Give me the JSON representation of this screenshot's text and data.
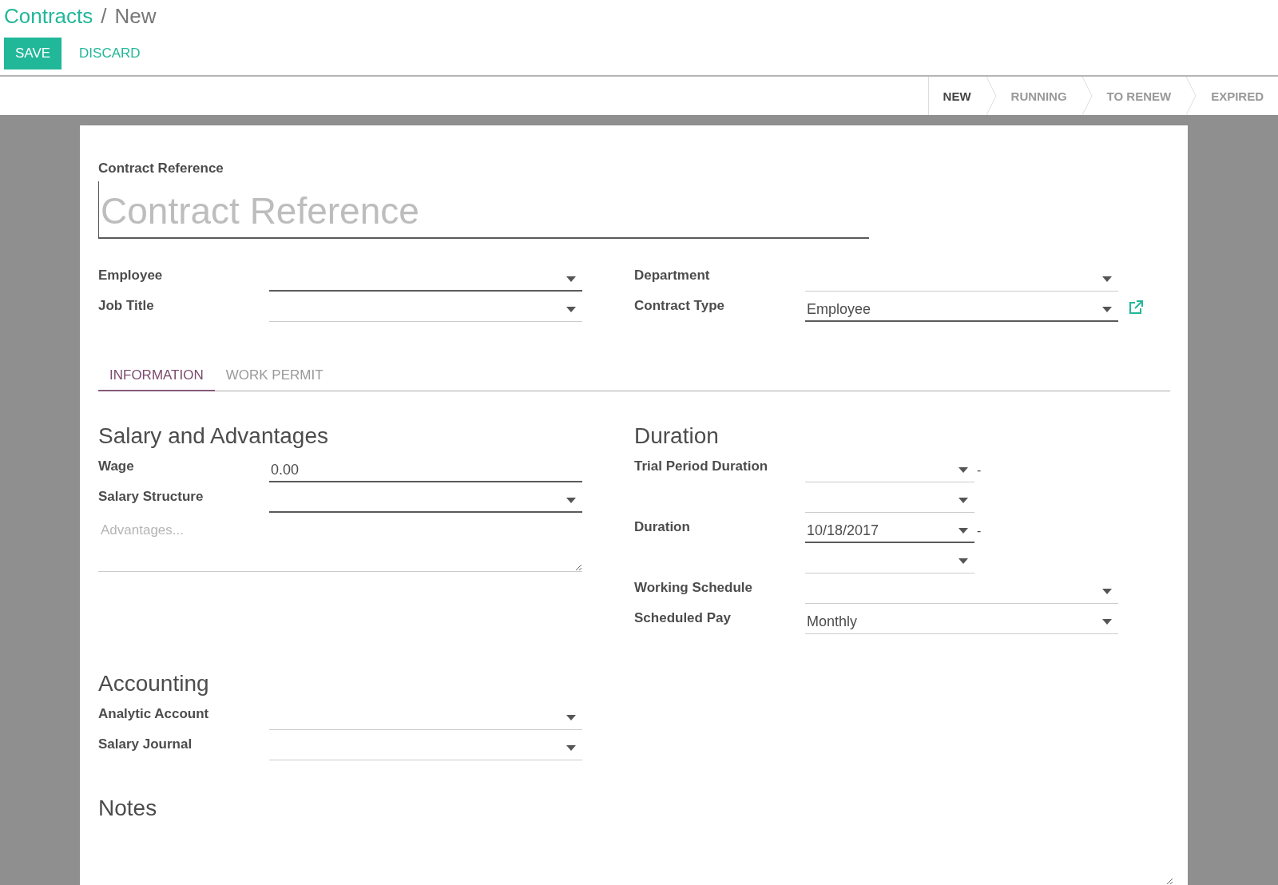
{
  "breadcrumb": {
    "parent": "Contracts",
    "separator": "/",
    "current": "New"
  },
  "buttons": [
    {
      "label": "SAVE",
      "kind": "primary"
    },
    {
      "label": "DISCARD",
      "kind": "link"
    }
  ],
  "status_steps": [
    {
      "label": "NEW",
      "selected": true
    },
    {
      "label": "RUNNING",
      "selected": false
    },
    {
      "label": "TO RENEW",
      "selected": false
    },
    {
      "label": "EXPIRED",
      "selected": false
    }
  ],
  "reference": {
    "label": "Contract Reference",
    "placeholder": "Contract Reference"
  },
  "top_fields": {
    "left": [
      {
        "label": "Employee",
        "fields": [
          {
            "kind": "select",
            "required": true
          }
        ]
      },
      {
        "label": "Job Title",
        "fields": [
          {
            "kind": "select",
            "required": false
          }
        ]
      }
    ],
    "right": [
      {
        "label": "Department",
        "fields": [
          {
            "kind": "select",
            "required": false
          }
        ]
      },
      {
        "label": "Contract Type",
        "fields": [
          {
            "kind": "select",
            "required": true,
            "value": "Employee",
            "link": true
          }
        ]
      }
    ]
  },
  "tabs": [
    {
      "label": "INFORMATION",
      "selected": true
    },
    {
      "label": "WORK PERMIT",
      "selected": false
    }
  ],
  "groups": [
    {
      "title": "Salary and Advantages",
      "rows": [
        {
          "label": "Wage",
          "fields": [
            {
              "kind": "text",
              "required": true,
              "value": "0.00"
            }
          ]
        },
        {
          "label": "Salary Structure",
          "fields": [
            {
              "kind": "select",
              "required": true
            }
          ]
        },
        {
          "fields": [
            {
              "kind": "textarea",
              "required": false,
              "placeholder": "Advantages..."
            }
          ]
        }
      ]
    },
    {
      "title": "Duration",
      "rows": [
        {
          "label": "Trial Period Duration",
          "fields": [
            {
              "kind": "date",
              "required": false,
              "suffix": "-"
            }
          ]
        },
        {
          "fields": [
            {
              "kind": "date",
              "required": false
            }
          ]
        },
        {
          "label": "Duration",
          "fields": [
            {
              "kind": "date",
              "required": true,
              "value": "10/18/2017",
              "suffix": "-"
            }
          ]
        },
        {
          "fields": [
            {
              "kind": "date",
              "required": false
            }
          ]
        },
        {
          "label": "Working Schedule",
          "fields": [
            {
              "kind": "select",
              "required": false
            }
          ]
        },
        {
          "label": "Scheduled Pay",
          "fields": [
            {
              "kind": "select",
              "required": false,
              "value": "Monthly"
            }
          ]
        }
      ]
    },
    {
      "title": "Accounting",
      "rows": [
        {
          "label": "Analytic Account",
          "fields": [
            {
              "kind": "select",
              "required": false
            }
          ]
        },
        {
          "label": "Salary Journal",
          "fields": [
            {
              "kind": "select",
              "required": false
            }
          ]
        }
      ]
    }
  ],
  "notes": {
    "title": "Notes"
  }
}
